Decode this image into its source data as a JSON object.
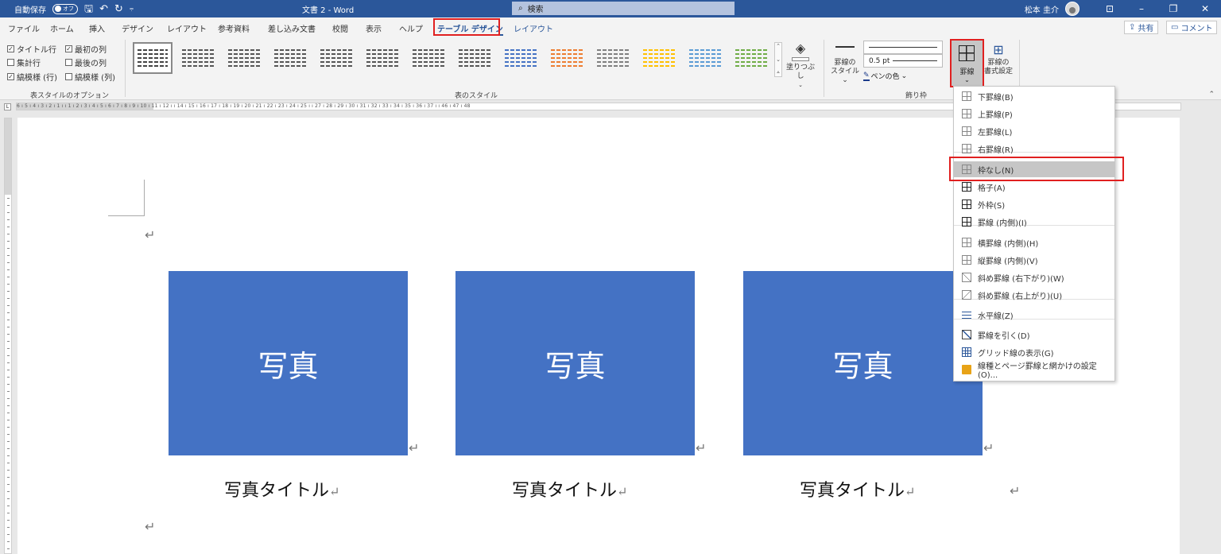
{
  "titlebar": {
    "autosave_label": "自動保存",
    "autosave_state": "オフ",
    "doc_title": "文書 2  -  Word",
    "search_placeholder": "検索",
    "user_name": "松本 圭介"
  },
  "tabs": [
    "ファイル",
    "ホーム",
    "挿入",
    "デザイン",
    "レイアウト",
    "参考資料",
    "差し込み文書",
    "校閲",
    "表示",
    "ヘルプ",
    "テーブル デザイン",
    "レイアウト"
  ],
  "actions": {
    "share": "共有",
    "comment": "コメント"
  },
  "ribbon": {
    "options": {
      "title_row": "タイトル行",
      "first_col": "最初の列",
      "total_row": "集計行",
      "last_col": "最後の列",
      "banded_rows": "縞模様 (行)",
      "banded_cols": "縞模様 (列)",
      "group_label": "表スタイルのオプション"
    },
    "styles_group_label": "表のスタイル",
    "shading_label": "塗りつぶし",
    "border_style_label_1": "罫線の",
    "border_style_label_2": "スタイル",
    "pen_weight": "0.5 pt",
    "pen_color": "ペンの色",
    "borders_btn": "罫線",
    "border_painter_1": "罫線の",
    "border_painter_2": "書式設定",
    "borders_group_label": "飾り枠",
    "style_colors": [
      "#444444",
      "#555555",
      "#555555",
      "#555555",
      "#555555",
      "#555555",
      "#555555",
      "#555555",
      "#4472c4",
      "#ed7d31",
      "#7f7f7f",
      "#ffc000",
      "#5b9bd5",
      "#70ad47"
    ]
  },
  "ruler": {
    "numbers": "6 ı 5 ı 4 ı 3 ı 2 ı 1 ı   ı 1 ı 2 ı 3 ı 4 ı 5 ı 6 ı 7 ı 8 ı 9 ı 10 ı 11 ı 12 ı   ı 14 ı 15 ı 16 ı 17 ı 18 ı 19 ı 20 ı 21 ı 22 ı 23 ı 24 ı 25 ı   ı 27 ı 28 ı 29 ı 30 ı 31 ı 32 ı 33 ı 34 ı 35 ı 36 ı 37 ı   ı 46 ı 47 ı 48",
    "corner": "L"
  },
  "document": {
    "photo_text": "写真",
    "caption": "写真タイトル",
    "return_mark": "↵"
  },
  "border_menu": {
    "items": [
      "下罫線(B)",
      "上罫線(P)",
      "左罫線(L)",
      "右罫線(R)",
      "枠なし(N)",
      "格子(A)",
      "外枠(S)",
      "罫線 (内側)(I)",
      "横罫線 (内側)(H)",
      "縦罫線 (内側)(V)",
      "斜め罫線 (右下がり)(W)",
      "斜め罫線 (右上がり)(U)",
      "水平線(Z)",
      "罫線を引く(D)",
      "グリッド線の表示(G)",
      "線種とページ罫線と網かけの設定(O)..."
    ]
  }
}
